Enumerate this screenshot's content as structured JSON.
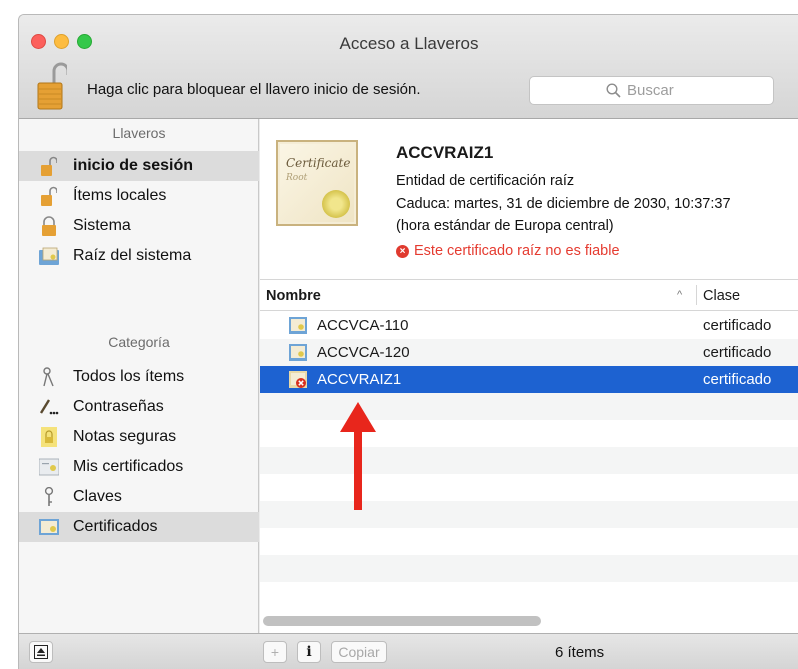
{
  "window": {
    "title": "Acceso a Llaveros",
    "lock_text": "Haga clic para bloquear el llavero inicio de sesión.",
    "search_placeholder": "Buscar"
  },
  "sidebar": {
    "keychains_header": "Llaveros",
    "keychains": [
      {
        "label": "inicio de sesión",
        "icon": "unlocked-padlock-icon",
        "selected": true
      },
      {
        "label": "Ítems locales",
        "icon": "unlocked-padlock-icon"
      },
      {
        "label": "Sistema",
        "icon": "locked-padlock-icon"
      },
      {
        "label": "Raíz del sistema",
        "icon": "folder-certificate-icon"
      }
    ],
    "category_header": "Categoría",
    "categories": [
      {
        "label": "Todos los ítems",
        "icon": "keys-icon"
      },
      {
        "label": "Contraseñas",
        "icon": "pen-dots-icon"
      },
      {
        "label": "Notas seguras",
        "icon": "note-icon"
      },
      {
        "label": "Mis certificados",
        "icon": "certificate-person-icon"
      },
      {
        "label": "Claves",
        "icon": "key-icon"
      },
      {
        "label": "Certificados",
        "icon": "certificate-icon",
        "selected": true
      }
    ]
  },
  "detail": {
    "image_text": "Certificate",
    "image_subtext": "Root",
    "name": "ACCVRAIZ1",
    "type": "Entidad de certificación raíz",
    "expires": "Caduca: martes, 31 de diciembre de 2030, 10:37:37",
    "timezone": "(hora estándar de Europa central)",
    "warning": "Este certificado raíz no es fiable",
    "warning_color": "#e53b30"
  },
  "table": {
    "col_name": "Nombre",
    "col_kind": "Clase",
    "rows": [
      {
        "name": "ACCVCA-110",
        "kind": "certificado"
      },
      {
        "name": "ACCVCA-120",
        "kind": "certificado"
      },
      {
        "name": "ACCVRAIZ1",
        "kind": "certificado",
        "selected": true
      }
    ]
  },
  "annotation": {
    "arrow_color": "#e8261c"
  },
  "bottom_bar": {
    "add_label": "+",
    "info_label": "i",
    "copy_label": "Copiar",
    "count": "6 ítems"
  },
  "colors": {
    "selection": "#1d62d1",
    "sidebar_selection": "#dcdcdc"
  }
}
